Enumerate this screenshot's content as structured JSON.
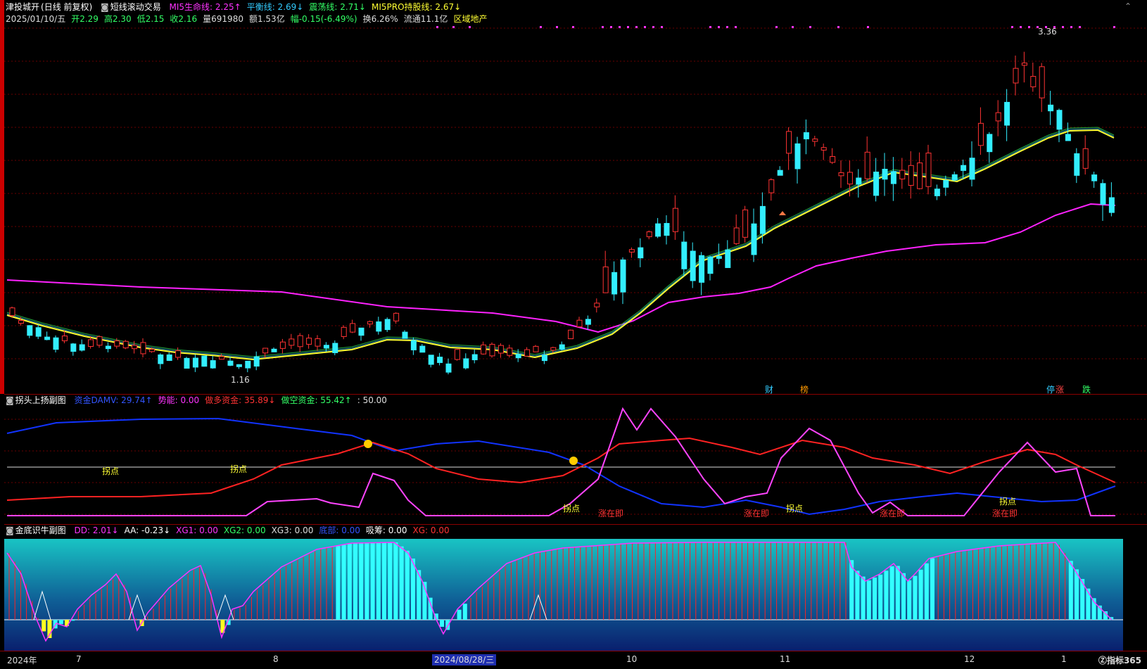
{
  "main": {
    "stock_name": "津投城开",
    "period": "(日线 前复权)",
    "indicator": "短线滚动交易",
    "ma_labels": [
      {
        "text": "MI5生命线: 2.25↑",
        "color": "#ff33ff"
      },
      {
        "text": "平衡线: 2.69↓",
        "color": "#33ccff"
      },
      {
        "text": "震荡线: 2.71↓",
        "color": "#33ff66"
      },
      {
        "text": "MI5PRO持股线: 2.67↓",
        "color": "#ffff33"
      }
    ],
    "info_line": [
      {
        "text": "2025/01/10/五",
        "color": "#dddddd"
      },
      {
        "text": "开2.29",
        "color": "#33ff66"
      },
      {
        "text": "高2.30",
        "color": "#33ff66"
      },
      {
        "text": "低2.15",
        "color": "#33ff66"
      },
      {
        "text": "收2.16",
        "color": "#33ff66"
      },
      {
        "text": "量691980",
        "color": "#dddddd"
      },
      {
        "text": "额1.53亿",
        "color": "#dddddd"
      },
      {
        "text": "幅-0.15(-6.49%)",
        "color": "#33ff66"
      },
      {
        "text": "换6.26%",
        "color": "#dddddd"
      },
      {
        "text": "流通11.1亿",
        "color": "#dddddd"
      },
      {
        "text": "区域地产",
        "color": "#ffff33"
      }
    ],
    "high_label": "3.36",
    "low_label": "1.16",
    "event_tags": [
      {
        "text": "财",
        "color": "#33ccff"
      },
      {
        "text": "榜",
        "color": "#ff9900"
      },
      {
        "text": "停",
        "color": "#33ccff"
      },
      {
        "text": "涨",
        "color": "#ff4444"
      },
      {
        "text": "跌",
        "color": "#33ff66"
      }
    ]
  },
  "sub1": {
    "title": "拐头上扬副图",
    "labels": [
      {
        "text": "资金DAMV: 29.74↑",
        "color": "#3355ff"
      },
      {
        "text": "势能: 0.00",
        "color": "#ff33ff"
      },
      {
        "text": "做多资金: 35.89↓",
        "color": "#ff3333"
      },
      {
        "text": "做空资金: 55.42↑",
        "color": "#33ff66"
      },
      {
        "text": ": 50.00",
        "color": "#dddddd"
      }
    ],
    "annotations": {
      "guaidian": "拐点",
      "zhangzaiji": "涨在即"
    }
  },
  "sub2": {
    "title": "金底识牛副图",
    "labels": [
      {
        "text": "DD: 2.01↓",
        "color": "#ff33ff"
      },
      {
        "text": "AA: -0.23↓",
        "color": "#ffffff"
      },
      {
        "text": "XG1: 0.00",
        "color": "#ff33ff"
      },
      {
        "text": "XG2: 0.00",
        "color": "#33ff66"
      },
      {
        "text": "XG3: 0.00",
        "color": "#dddddd"
      },
      {
        "text": "底部: 0.00",
        "color": "#3355ff"
      },
      {
        "text": "吸筹: 0.00",
        "color": "#ffffff"
      },
      {
        "text": "XG: 0.00",
        "color": "#ff3333"
      }
    ]
  },
  "axis": {
    "labels": [
      "2024年",
      "7",
      "8",
      "10",
      "11",
      "12",
      "1"
    ],
    "selected_date": "2024/08/28/三",
    "brand": "指标365"
  }
}
